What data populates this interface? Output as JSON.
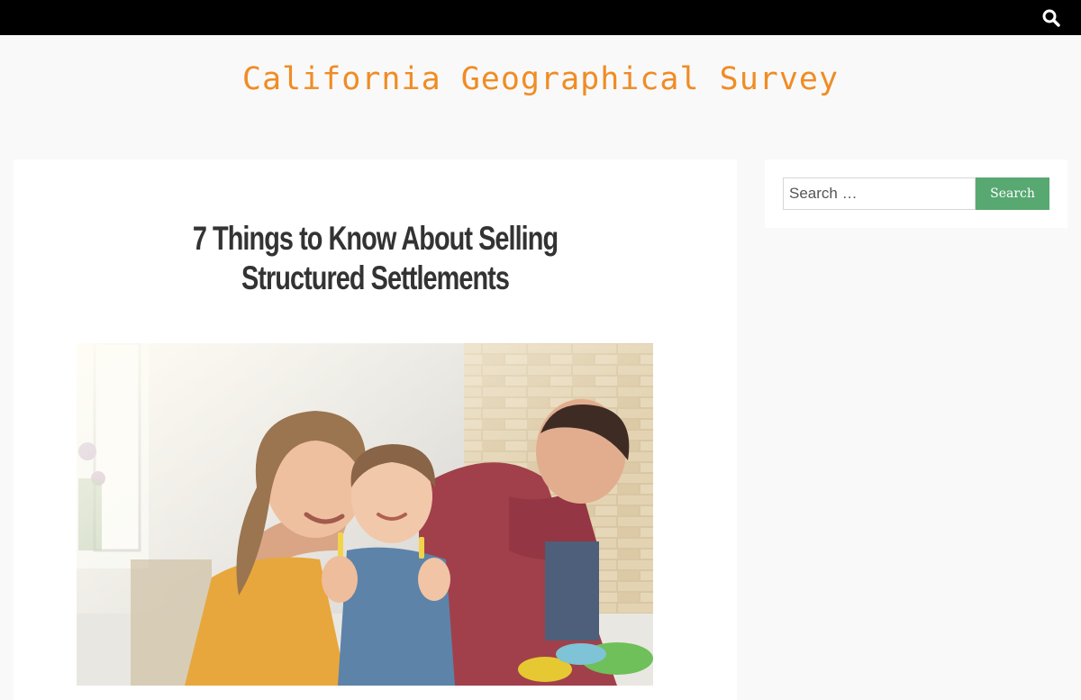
{
  "header": {
    "site_title": "California Geographical Survey",
    "search_icon": "search-icon"
  },
  "post": {
    "title": "7 Things to Know About Selling Structured Settlements",
    "image_alt": "family-photo"
  },
  "sidebar": {
    "search_placeholder": "Search …",
    "search_button": "Search"
  },
  "colors": {
    "topbar": "#000000",
    "site_title": "#f08c24",
    "search_button": "#58a872",
    "background": "#f9f9f9"
  }
}
